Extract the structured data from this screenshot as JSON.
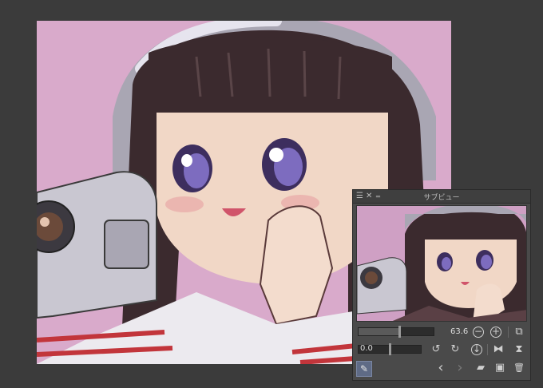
{
  "subview": {
    "title": "サブビュー",
    "zoom_value": "63.6",
    "rotation_value": "0.0"
  },
  "icons": {
    "menu": "☰",
    "close": "✕",
    "minimize": "‗",
    "zoom_out": "−",
    "zoom_in": "+",
    "fit": "⧉",
    "rotate_left": "↺",
    "rotate_right": "↻",
    "reset": "↓",
    "flip_h": "⧓",
    "flip_v": "⧗",
    "eyedropper": "✎",
    "prev": "‹",
    "next": "›",
    "open": "▰",
    "import": "▣",
    "delete": "🗑"
  },
  "colors": {
    "panel_bg": "#4a4a4a",
    "app_bg": "#3b3b3b",
    "canvas_bg": "#d9aacb"
  }
}
